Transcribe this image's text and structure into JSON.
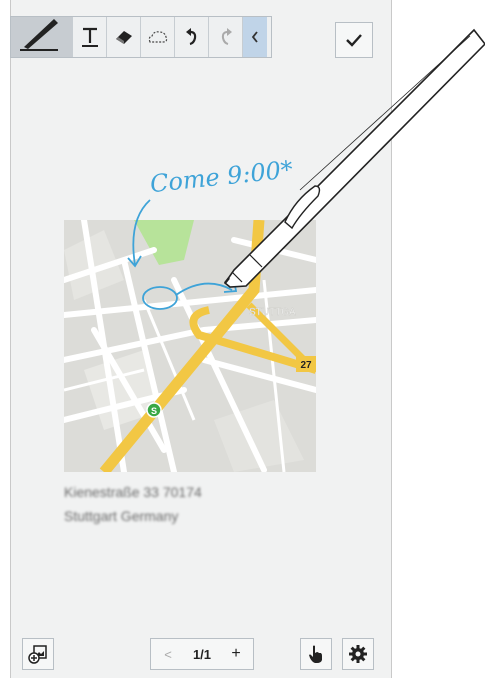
{
  "toolbar": {
    "tools": [
      "pen-tool",
      "text-tool",
      "eraser-tool",
      "selection-tool",
      "undo",
      "redo",
      "collapse"
    ],
    "done_icon": "checkmark-icon"
  },
  "note": {
    "handwriting": "Come 9:00*"
  },
  "map": {
    "district_label": "STUTTGA",
    "route_badge": "27",
    "transit_badge": "S"
  },
  "address": {
    "line1": "Kienestraße 33 70174",
    "line2": "Stuttgart Germany"
  },
  "bottom_bar": {
    "prev_label": "<",
    "page_indicator": "1/1",
    "add_label": "+"
  },
  "colors": {
    "road_major": "#f2c744",
    "road_minor": "#ffffff",
    "map_bg": "#dcdcd8",
    "park": "#b7e39a",
    "ink": "#3ea3d8",
    "collapse_tab": "#c0d4e8"
  }
}
